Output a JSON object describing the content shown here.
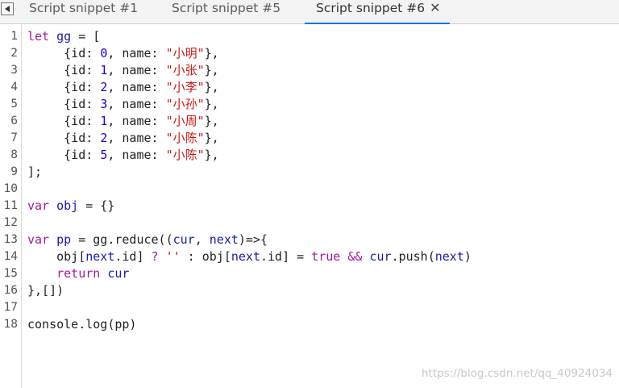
{
  "tabs": [
    {
      "label": "Script snippet #1"
    },
    {
      "label": "Script snippet #5"
    },
    {
      "label": "Script snippet #6",
      "active": true
    }
  ],
  "icons": {
    "back": "back-triangle-icon",
    "close": "close-icon"
  },
  "colors": {
    "keyword": "#a4199e",
    "string": "#c41a16",
    "number": "#1c00cf",
    "variable": "#1a1aa6",
    "active_tab_indicator": "#1a73e8"
  },
  "editor": {
    "lines": [
      [
        {
          "t": "let",
          "c": "kw"
        },
        {
          "t": " "
        },
        {
          "t": "gg",
          "c": "var"
        },
        {
          "t": " = ["
        }
      ],
      [
        {
          "t": "     {id: "
        },
        {
          "t": "0",
          "c": "num"
        },
        {
          "t": ", name: "
        },
        {
          "t": "\"小明\"",
          "c": "str"
        },
        {
          "t": "},"
        }
      ],
      [
        {
          "t": "     {id: "
        },
        {
          "t": "1",
          "c": "num"
        },
        {
          "t": ", name: "
        },
        {
          "t": "\"小张\"",
          "c": "str"
        },
        {
          "t": "},"
        }
      ],
      [
        {
          "t": "     {id: "
        },
        {
          "t": "2",
          "c": "num"
        },
        {
          "t": ", name: "
        },
        {
          "t": "\"小李\"",
          "c": "str"
        },
        {
          "t": "},"
        }
      ],
      [
        {
          "t": "     {id: "
        },
        {
          "t": "3",
          "c": "num"
        },
        {
          "t": ", name: "
        },
        {
          "t": "\"小孙\"",
          "c": "str"
        },
        {
          "t": "},"
        }
      ],
      [
        {
          "t": "     {id: "
        },
        {
          "t": "1",
          "c": "num"
        },
        {
          "t": ", name: "
        },
        {
          "t": "\"小周\"",
          "c": "str"
        },
        {
          "t": "},"
        }
      ],
      [
        {
          "t": "     {id: "
        },
        {
          "t": "2",
          "c": "num"
        },
        {
          "t": ", name: "
        },
        {
          "t": "\"小陈\"",
          "c": "str"
        },
        {
          "t": "},"
        }
      ],
      [
        {
          "t": "     {id: "
        },
        {
          "t": "5",
          "c": "num"
        },
        {
          "t": ", name: "
        },
        {
          "t": "\"小陈\"",
          "c": "str"
        },
        {
          "t": "},"
        }
      ],
      [
        {
          "t": "];"
        }
      ],
      [],
      [
        {
          "t": "var",
          "c": "kw"
        },
        {
          "t": " "
        },
        {
          "t": "obj",
          "c": "var"
        },
        {
          "t": " = {}"
        }
      ],
      [],
      [
        {
          "t": "var",
          "c": "kw"
        },
        {
          "t": " "
        },
        {
          "t": "pp",
          "c": "var"
        },
        {
          "t": " = gg.reduce(("
        },
        {
          "t": "cur",
          "c": "var"
        },
        {
          "t": ", "
        },
        {
          "t": "next",
          "c": "var"
        },
        {
          "t": ")=>{"
        }
      ],
      [
        {
          "t": "    obj["
        },
        {
          "t": "next",
          "c": "var"
        },
        {
          "t": ".id] "
        },
        {
          "t": "?",
          "c": "kw"
        },
        {
          "t": " "
        },
        {
          "t": "''",
          "c": "str"
        },
        {
          "t": " : obj["
        },
        {
          "t": "next",
          "c": "var"
        },
        {
          "t": ".id] = "
        },
        {
          "t": "true",
          "c": "kw"
        },
        {
          "t": " "
        },
        {
          "t": "&&",
          "c": "kw"
        },
        {
          "t": " "
        },
        {
          "t": "cur",
          "c": "var"
        },
        {
          "t": ".push("
        },
        {
          "t": "next",
          "c": "var"
        },
        {
          "t": ")"
        }
      ],
      [
        {
          "t": "    "
        },
        {
          "t": "return",
          "c": "kw"
        },
        {
          "t": " "
        },
        {
          "t": "cur",
          "c": "var"
        }
      ],
      [
        {
          "t": "},[])"
        }
      ],
      [],
      [
        {
          "t": "console.log(pp)"
        }
      ]
    ]
  },
  "watermark": "https://blog.csdn.net/qq_40924034"
}
